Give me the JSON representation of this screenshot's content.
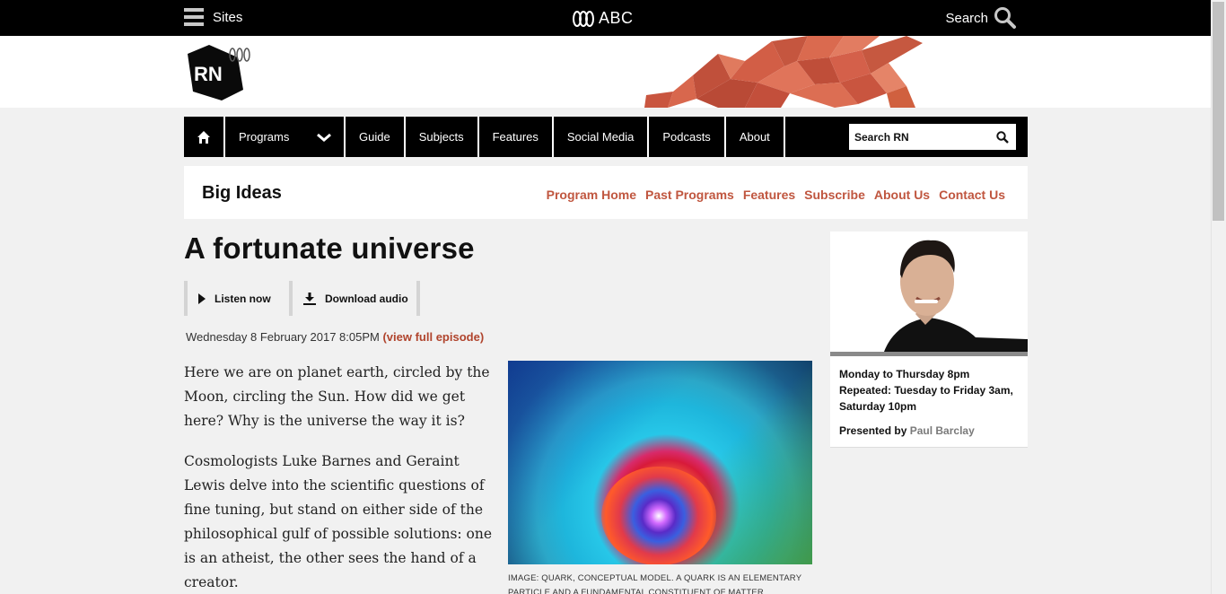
{
  "topbar": {
    "sites_label": "Sites",
    "brand_label": "ABC",
    "search_label": "Search"
  },
  "branding": {
    "logo_text": "RN",
    "accent_color": "#c0563f"
  },
  "nav": {
    "items": [
      "Programs",
      "Guide",
      "Subjects",
      "Features",
      "Social Media",
      "Podcasts",
      "About"
    ],
    "search_placeholder": "Search RN"
  },
  "program": {
    "title": "Big Ideas",
    "links": [
      "Program Home",
      "Past Programs",
      "Features",
      "Subscribe",
      "About Us",
      "Contact Us"
    ]
  },
  "article": {
    "title": "A fortunate universe",
    "listen_label": "Listen now",
    "download_label": "Download audio",
    "date": "Wednesday 8 February 2017 8:05PM",
    "full_episode_link": "(view full episode)",
    "paragraphs": [
      "Here we are on planet earth, circled by the Moon, circling the Sun. How did we get here? Why is the universe the way it is?",
      "Cosmologists Luke Barnes and Geraint Lewis delve into the scientific questions of fine tuning, but stand on either side of the philosophical gulf of possible solutions: one is an atheist, the other sees the hand of a creator."
    ],
    "image_caption": "IMAGE: QUARK, CONCEPTUAL MODEL. A QUARK IS AN ELEMENTARY PARTICLE AND A FUNDAMENTAL CONSTITUENT OF MATTER."
  },
  "presenter": {
    "schedule": "Monday to Thursday 8pm Repeated: Tuesday to Friday 3am, Saturday 10pm",
    "presented_by_label": "Presented by",
    "presenter_name": "Paul Barclay"
  }
}
